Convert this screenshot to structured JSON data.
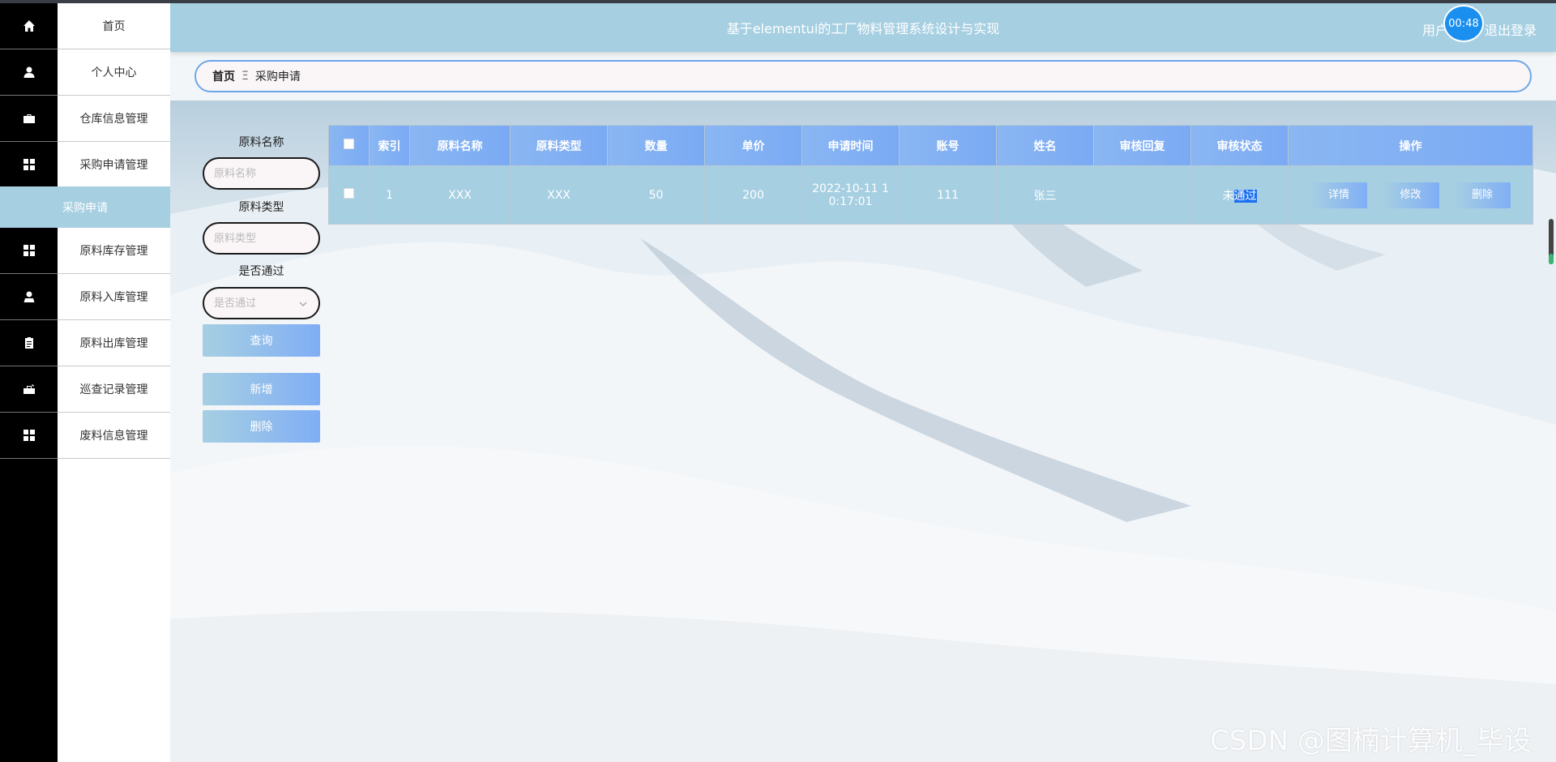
{
  "header": {
    "title": "基于elementui的工厂物料管理系统设计与实现",
    "user_label": "用户",
    "timer": "00:48",
    "logout_label": "退出登录"
  },
  "sidebar": {
    "items": [
      {
        "label": "首页",
        "icon": "home-icon"
      },
      {
        "label": "个人中心",
        "icon": "user-icon"
      },
      {
        "label": "仓库信息管理",
        "icon": "briefcase-icon"
      },
      {
        "label": "采购申请管理",
        "icon": "grid-icon"
      },
      {
        "label": "原料库存管理",
        "icon": "grid-icon"
      },
      {
        "label": "原料入库管理",
        "icon": "user-badge-icon"
      },
      {
        "label": "原料出库管理",
        "icon": "clipboard-icon"
      },
      {
        "label": "巡查记录管理",
        "icon": "toolbox-icon"
      },
      {
        "label": "废料信息管理",
        "icon": "grid-icon"
      }
    ],
    "active_sub": "采购申请"
  },
  "breadcrumb": {
    "home": "首页",
    "separator": "Ξ",
    "current": "采购申请"
  },
  "search": {
    "name_label": "原料名称",
    "name_placeholder": "原料名称",
    "type_label": "原料类型",
    "type_placeholder": "原料类型",
    "pass_label": "是否通过",
    "pass_placeholder": "是否通过",
    "query_button": "查询",
    "add_button": "新增",
    "delete_button": "删除"
  },
  "table": {
    "headers": [
      "索引",
      "原料名称",
      "原料类型",
      "数量",
      "单价",
      "申请时间",
      "账号",
      "姓名",
      "审核回复",
      "审核状态",
      "操作"
    ],
    "rows": [
      {
        "index": "1",
        "name": "XXX",
        "type": "XXX",
        "quantity": "50",
        "price": "200",
        "time_line1": "2022-10-11 1",
        "time_line2": "0:17:01",
        "account": "111",
        "person": "张三",
        "reply": "",
        "status_prefix": "未",
        "status_selected": "通过",
        "actions": [
          "详情",
          "修改",
          "删除"
        ]
      }
    ]
  },
  "watermark": "CSDN @图楠计算机_毕设",
  "colors": {
    "sidebar_rail": "#000000",
    "accent": "#a6cfe2",
    "header_table": "#7aaaf4",
    "selection": "#1a6ff0"
  }
}
